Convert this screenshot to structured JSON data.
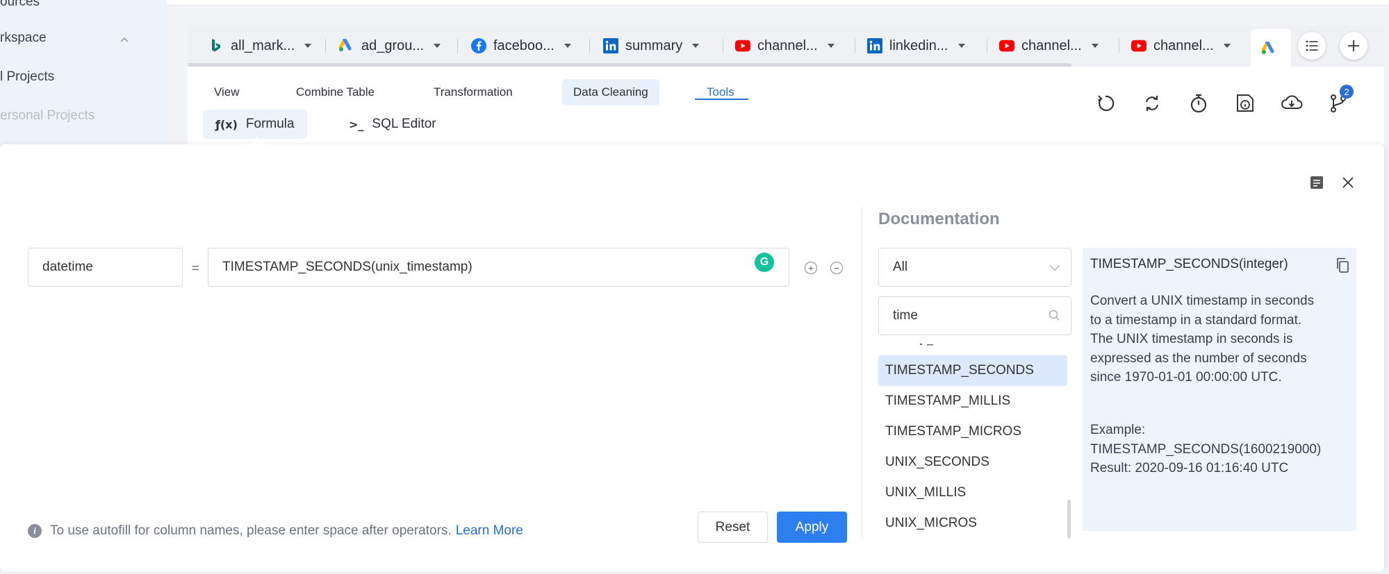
{
  "sidebar": {
    "items": [
      {
        "label": "ources"
      },
      {
        "label": "rkspace"
      },
      {
        "label": "l Projects"
      },
      {
        "label": "ersonal Projects"
      }
    ]
  },
  "tabs": [
    {
      "label": "all_mark...",
      "icon": "bing-icon"
    },
    {
      "label": "ad_grou...",
      "icon": "google-ads-icon"
    },
    {
      "label": "faceboo...",
      "icon": "facebook-icon"
    },
    {
      "label": "summary",
      "icon": "linkedin-icon"
    },
    {
      "label": "channel...",
      "icon": "youtube-icon"
    },
    {
      "label": "linkedin...",
      "icon": "linkedin-icon"
    },
    {
      "label": "channel...",
      "icon": "youtube-icon"
    },
    {
      "label": "channel...",
      "icon": "youtube-icon"
    }
  ],
  "toolbar": {
    "menu": [
      "View",
      "Combine Table",
      "Transformation",
      "Data Cleaning",
      "Tools"
    ],
    "subtools": [
      {
        "icon_text": "ƒ(x)",
        "label": "Formula"
      },
      {
        "icon_text": ">_",
        "label": "SQL Editor"
      }
    ],
    "badge_count": "2"
  },
  "formula": {
    "column_name": "datetime",
    "equals": "=",
    "expression": "TIMESTAMP_SECONDS(unix_timestamp)",
    "grammarly": "G",
    "add": "+",
    "remove": "−"
  },
  "documentation": {
    "title": "Documentation",
    "category": "All",
    "search": "time",
    "functions": [
      "TIMESTAMP_SECONDS",
      "TIMESTAMP_MILLIS",
      "TIMESTAMP_MICROS",
      "UNIX_SECONDS",
      "UNIX_MILLIS",
      "UNIX_MICROS"
    ],
    "signature": "TIMESTAMP_SECONDS(integer)",
    "description": "Convert a UNIX timestamp in seconds to a timestamp in a standard format. The UNIX timestamp in seconds is expressed as the number of seconds since 1970-01-01 00:00:00 UTC.",
    "example_label": "Example:",
    "example": "TIMESTAMP_SECONDS(1600219000)",
    "result": "Result: 2020-09-16 01:16:40 UTC"
  },
  "footer": {
    "info_icon": "i",
    "hint": "To use autofill for column names, please enter space after operators.",
    "learn_more": "Learn More",
    "reset": "Reset",
    "apply": "Apply"
  },
  "colors": {
    "accent": "#2d7ff0",
    "selection": "#dce8fb",
    "doc_panel": "#eef3fc"
  }
}
